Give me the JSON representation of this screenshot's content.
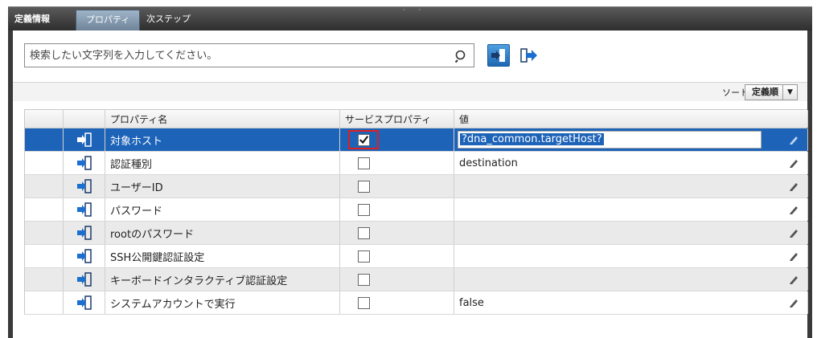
{
  "tabs": [
    {
      "label": "定義情報"
    },
    {
      "label": "プロパティ"
    },
    {
      "label": "次ステップ"
    }
  ],
  "search": {
    "placeholder": "検索したい文字列を入力してください。",
    "value": ""
  },
  "sort": {
    "label": "ソート:",
    "selected": "定義順"
  },
  "columns": {
    "name": "プロパティ名",
    "service": "サービスプロパティ",
    "value": "値"
  },
  "rows": [
    {
      "name": "対象ホスト",
      "service_property": true,
      "value": "?dna_common.targetHost?",
      "selected": true
    },
    {
      "name": "認証種別",
      "service_property": false,
      "value": "destination"
    },
    {
      "name": "ユーザーID",
      "service_property": false,
      "value": ""
    },
    {
      "name": "パスワード",
      "service_property": false,
      "value": ""
    },
    {
      "name": "rootのパスワード",
      "service_property": false,
      "value": ""
    },
    {
      "name": "SSH公開鍵認証設定",
      "service_property": false,
      "value": ""
    },
    {
      "name": "キーボードインタラクティブ認証設定",
      "service_property": false,
      "value": ""
    },
    {
      "name": "システムアカウントで実行",
      "service_property": false,
      "value": "false"
    }
  ],
  "colors": {
    "selection": "#1d63b8",
    "highlight": "#e02020",
    "tabbar": "#3a3a3a"
  },
  "icons": {
    "search": "search-icon",
    "import": "import-icon",
    "export": "export-icon",
    "edit": "pencil-icon",
    "property": "property-input-icon"
  }
}
